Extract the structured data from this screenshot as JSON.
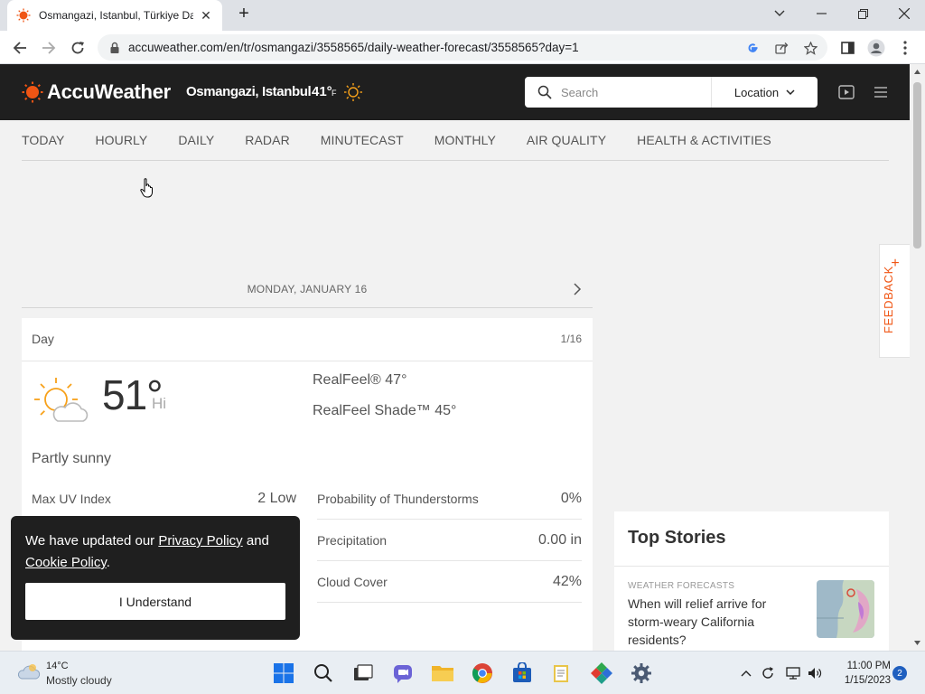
{
  "browser": {
    "tab_title": "Osmangazi, Istanbul, Türkiye Day",
    "url": "accuweather.com/en/tr/osmangazi/3558565/daily-weather-forecast/3558565?day=1"
  },
  "site": {
    "brand": "AccuWeather",
    "location": "Osmangazi, Istanbul",
    "current_temp": "41°",
    "unit": "F",
    "search_placeholder": "Search",
    "location_button": "Location"
  },
  "nav": [
    "TODAY",
    "HOURLY",
    "DAILY",
    "RADAR",
    "MINUTECAST",
    "MONTHLY",
    "AIR QUALITY",
    "HEALTH & ACTIVITIES"
  ],
  "day_header": {
    "date": "MONDAY, JANUARY 16"
  },
  "card": {
    "label": "Day",
    "pager": "1/16",
    "temp": "51°",
    "hi_label": "Hi",
    "realfeel": "RealFeel® 47°",
    "realfeel_shade": "RealFeel Shade™ 45°",
    "phrase": "Partly sunny",
    "stats_left": [
      {
        "label": "Max UV Index",
        "value": "2 Low"
      }
    ],
    "stats_right": [
      {
        "label": "Probability of Thunderstorms",
        "value": "0%"
      },
      {
        "label": "Precipitation",
        "value": "0.00 in"
      },
      {
        "label": "Cloud Cover",
        "value": "42%"
      }
    ]
  },
  "feedback": "FEEDBACK",
  "top_stories": {
    "title": "Top Stories",
    "category": "WEATHER FORECASTS",
    "headline": "When will relief arrive for storm-weary California residents?"
  },
  "cookie": {
    "text_before": "We have updated our ",
    "privacy_link": "Privacy Policy",
    "text_mid": " and ",
    "cookie_link": "Cookie Policy",
    "text_after": ".",
    "button": "I Understand"
  },
  "taskbar": {
    "weather_temp": "14°C",
    "weather_cond": "Mostly cloudy",
    "time": "11:00 PM",
    "date": "1/15/2023",
    "notifications": "2"
  },
  "colors": {
    "accent": "#f05514",
    "header_bg": "#1f1f1f"
  }
}
